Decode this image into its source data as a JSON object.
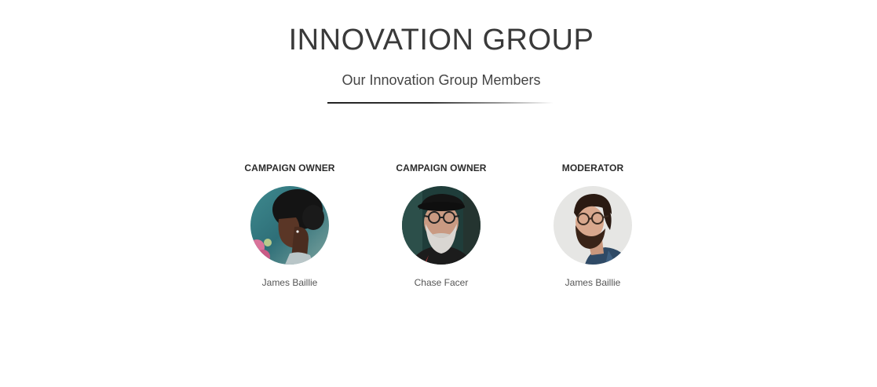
{
  "header": {
    "title": "INNOVATION GROUP",
    "subtitle": "Our Innovation Group Members"
  },
  "members": [
    {
      "role": "CAMPAIGN OWNER",
      "name": "James Baillie",
      "avatar_icon": "woman-portrait-avatar"
    },
    {
      "role": "CAMPAIGN OWNER",
      "name": "Chase Facer",
      "avatar_icon": "older-man-glasses-avatar"
    },
    {
      "role": "MODERATOR",
      "name": "James Baillie",
      "avatar_icon": "bearded-man-glasses-avatar"
    }
  ],
  "colors": {
    "title": "#3a3a3a",
    "divider": "#222222",
    "background": "#ffffff"
  }
}
